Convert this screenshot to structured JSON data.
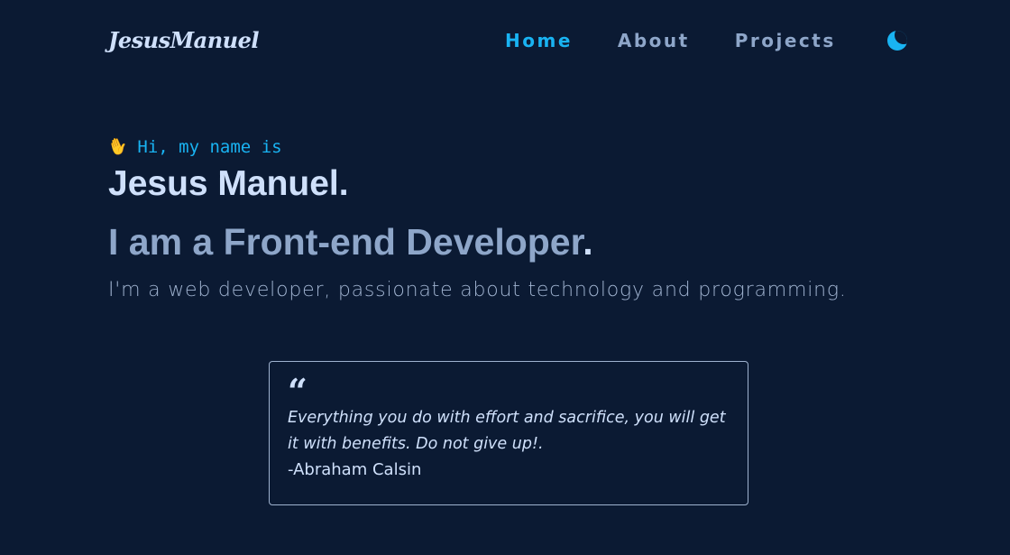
{
  "header": {
    "logo": "JesusManuel",
    "nav": [
      {
        "label": "Home",
        "active": true
      },
      {
        "label": "About",
        "active": false
      },
      {
        "label": "Projects",
        "active": false
      }
    ],
    "theme_toggle_icon": "moon-icon"
  },
  "hero": {
    "greeting_icon": "waving-hand-icon",
    "greeting": "Hi, my name is",
    "name": "Jesus Manuel",
    "role": "I am a Front-end Developer",
    "intro": "I'm a web developer, passionate about technology and programming."
  },
  "quote": {
    "mark": "“",
    "text": "Everything you do with effort and sacrifice, you will get it with benefits. Do not give up!.",
    "author": "-Abraham Calsin"
  },
  "colors": {
    "background": "#0b1a33",
    "accent": "#19b3f2",
    "heading": "#cfe0fb",
    "muted": "#8ea6c9"
  }
}
